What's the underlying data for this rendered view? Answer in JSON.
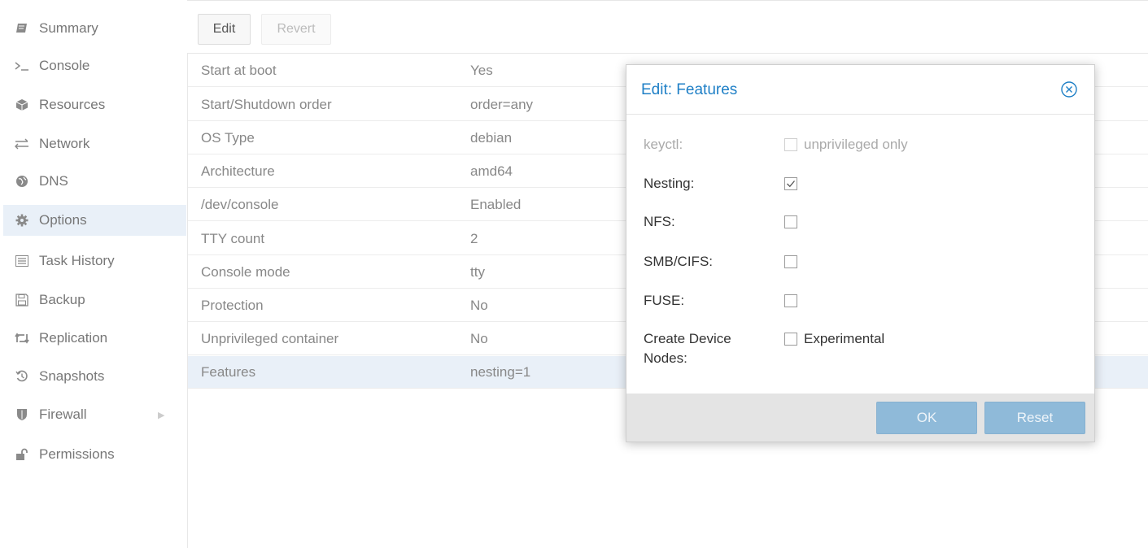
{
  "sidebar": {
    "items": [
      {
        "label": "Summary",
        "icon": "book-icon"
      },
      {
        "label": "Console",
        "icon": "terminal-icon"
      },
      {
        "label": "Resources",
        "icon": "cube-icon"
      },
      {
        "label": "Network",
        "icon": "exchange-icon"
      },
      {
        "label": "DNS",
        "icon": "globe-icon"
      },
      {
        "label": "Options",
        "icon": "gear-icon",
        "active": true
      },
      {
        "label": "Task History",
        "icon": "list-icon"
      },
      {
        "label": "Backup",
        "icon": "floppy-icon"
      },
      {
        "label": "Replication",
        "icon": "retweet-icon"
      },
      {
        "label": "Snapshots",
        "icon": "history-icon"
      },
      {
        "label": "Firewall",
        "icon": "shield-icon"
      },
      {
        "label": "Permissions",
        "icon": "unlock-icon"
      }
    ]
  },
  "toolbar": {
    "edit_label": "Edit",
    "revert_label": "Revert"
  },
  "options": [
    {
      "key": "Start at boot",
      "value": "Yes"
    },
    {
      "key": "Start/Shutdown order",
      "value": "order=any"
    },
    {
      "key": "OS Type",
      "value": "debian"
    },
    {
      "key": "Architecture",
      "value": "amd64"
    },
    {
      "key": "/dev/console",
      "value": "Enabled"
    },
    {
      "key": "TTY count",
      "value": "2"
    },
    {
      "key": "Console mode",
      "value": "tty"
    },
    {
      "key": "Protection",
      "value": "No"
    },
    {
      "key": "Unprivileged container",
      "value": "No"
    },
    {
      "key": "Features",
      "value": "nesting=1"
    }
  ],
  "dialog": {
    "title": "Edit: Features",
    "fields": {
      "keyctl": {
        "label": "keyctl:",
        "box_label": "unprivileged only",
        "checked": false,
        "disabled": true
      },
      "nesting": {
        "label": "Nesting:",
        "checked": true
      },
      "nfs": {
        "label": "NFS:",
        "checked": false
      },
      "smb": {
        "label": "SMB/CIFS:",
        "checked": false
      },
      "fuse": {
        "label": "FUSE:",
        "checked": false
      },
      "mknod": {
        "label_line1": "Create Device",
        "label_line2": "Nodes:",
        "box_label": "Experimental",
        "checked": false
      }
    },
    "ok_label": "OK",
    "reset_label": "Reset"
  },
  "colors": {
    "accent": "#1e7fc6",
    "selected_row": "#e9f0f8",
    "dialog_button": "#8fbad9"
  }
}
